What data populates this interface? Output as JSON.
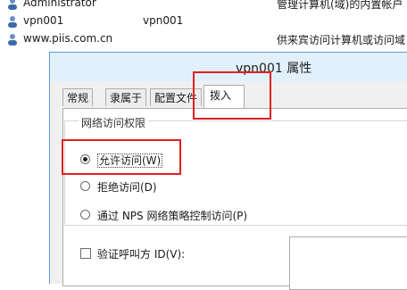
{
  "user_list": [
    {
      "name": "Administrator",
      "full_name": "",
      "description": "管理计算机(域)的内置帐户",
      "icon": "user-icon"
    },
    {
      "name": "vpn001",
      "full_name": "vpn001",
      "description": "",
      "icon": "user-icon"
    },
    {
      "name": "www.piis.com.cn",
      "full_name": "",
      "description": "供来宾访问计算机或访问域",
      "icon": "user-icon"
    }
  ],
  "dialog": {
    "title": "vpn001 属性",
    "tabs": [
      {
        "label": "常规",
        "active": false
      },
      {
        "label": "隶属于",
        "active": false
      },
      {
        "label": "配置文件",
        "active": false
      },
      {
        "label": "拨入",
        "active": true
      }
    ],
    "network_access": {
      "group_label": "网络访问权限",
      "options": [
        {
          "label": "允许访问(W)",
          "checked": true
        },
        {
          "label": "拒绝访问(D)",
          "checked": false
        },
        {
          "label": "通过 NPS 网络策略控制访问(P)",
          "checked": false
        }
      ]
    },
    "verify_caller_id": {
      "label": "验证呼叫方 ID(V):",
      "checked": false
    }
  },
  "colors": {
    "highlight": "#e02020",
    "titlebar": "#e1f0fb",
    "dialog_border": "#5b9bd5"
  }
}
